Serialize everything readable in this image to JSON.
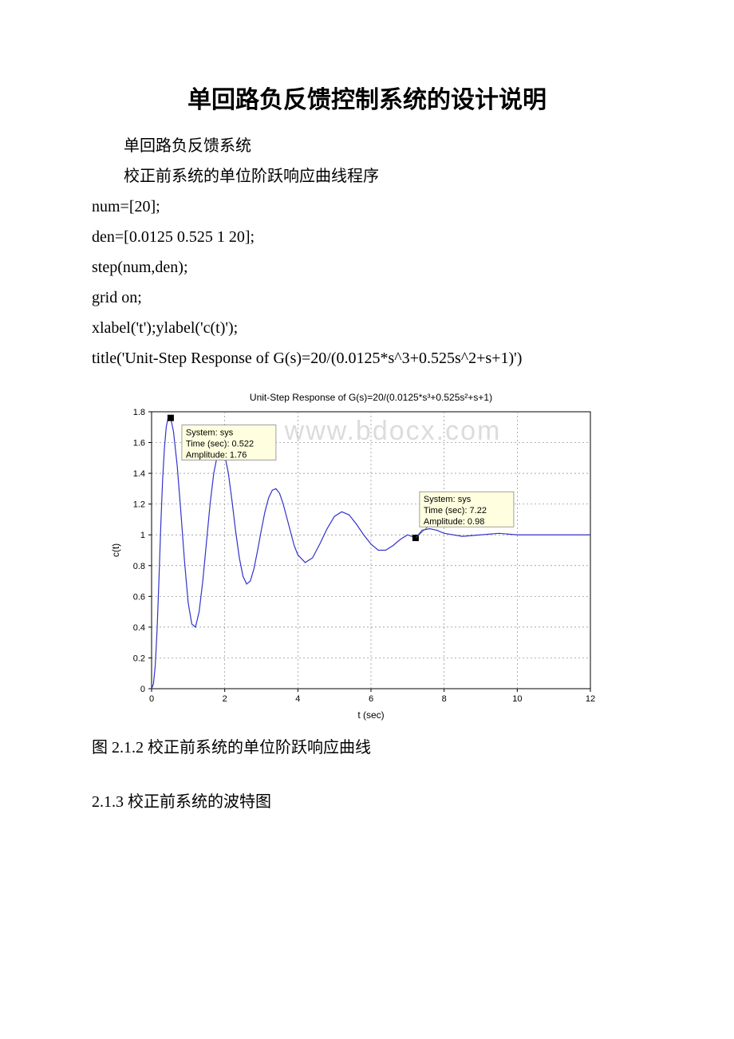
{
  "title": "单回路负反馈控制系统的设计说明",
  "lines": {
    "l1": "单回路负反馈系统",
    "l2": "校正前系统的单位阶跃响应曲线程序",
    "c1": "num=[20];",
    "c2": "den=[0.0125 0.525 1 20];",
    "c3": "step(num,den);",
    "c4": "grid on;",
    "c5": "xlabel('t');ylabel('c(t)');",
    "c6": "title('Unit-Step Response of G(s)=20/(0.0125*s^3+0.525s^2+s+1)')"
  },
  "caption": "图 2.1.2 校正前系统的单位阶跃响应曲线",
  "section": "2.1.3 校正前系统的波特图",
  "watermark": "www.bdocx.com",
  "chart_data": {
    "type": "line",
    "title": "Unit-Step Response of G(s)=20/(0.0125*s³+0.525s²+s+1)",
    "xlabel": "t (sec)",
    "ylabel": "c(t)",
    "xlim": [
      0,
      12
    ],
    "ylim": [
      0,
      1.8
    ],
    "xticks": [
      0,
      2,
      4,
      6,
      8,
      10,
      12
    ],
    "yticks": [
      0,
      0.2,
      0.4,
      0.6,
      0.8,
      1,
      1.2,
      1.4,
      1.6,
      1.8
    ],
    "grid": true,
    "series": [
      {
        "name": "sys",
        "color": "#3333cc",
        "x": [
          0,
          0.05,
          0.1,
          0.15,
          0.2,
          0.25,
          0.3,
          0.35,
          0.4,
          0.45,
          0.522,
          0.6,
          0.7,
          0.8,
          0.9,
          1.0,
          1.1,
          1.2,
          1.3,
          1.4,
          1.5,
          1.6,
          1.7,
          1.8,
          1.9,
          2.0,
          2.1,
          2.2,
          2.3,
          2.4,
          2.5,
          2.6,
          2.7,
          2.8,
          2.9,
          3.0,
          3.1,
          3.2,
          3.3,
          3.4,
          3.5,
          3.6,
          3.7,
          3.8,
          3.9,
          4.0,
          4.2,
          4.4,
          4.6,
          4.8,
          5.0,
          5.2,
          5.4,
          5.6,
          5.8,
          6.0,
          6.2,
          6.4,
          6.6,
          6.8,
          7.0,
          7.22,
          7.4,
          7.6,
          7.8,
          8.0,
          8.5,
          9.0,
          9.5,
          10.0,
          10.5,
          11.0,
          11.5,
          12.0
        ],
        "y": [
          0,
          0.03,
          0.15,
          0.38,
          0.7,
          1.05,
          1.35,
          1.56,
          1.7,
          1.76,
          1.76,
          1.67,
          1.45,
          1.15,
          0.83,
          0.56,
          0.42,
          0.4,
          0.5,
          0.7,
          0.95,
          1.2,
          1.4,
          1.52,
          1.56,
          1.52,
          1.4,
          1.22,
          1.02,
          0.85,
          0.73,
          0.68,
          0.7,
          0.78,
          0.9,
          1.03,
          1.15,
          1.24,
          1.29,
          1.3,
          1.27,
          1.2,
          1.11,
          1.02,
          0.93,
          0.87,
          0.82,
          0.85,
          0.94,
          1.04,
          1.12,
          1.15,
          1.13,
          1.07,
          1.0,
          0.94,
          0.9,
          0.9,
          0.93,
          0.97,
          1.0,
          0.98,
          1.03,
          1.04,
          1.03,
          1.01,
          0.99,
          1.0,
          1.01,
          1.0,
          1.0,
          1.0,
          1.0,
          1.0
        ]
      }
    ],
    "annotations": [
      {
        "label": "System: sys",
        "sub1": "Time (sec): 0.522",
        "sub2": "Amplitude: 1.76",
        "x": 0.522,
        "y": 1.76
      },
      {
        "label": "System: sys",
        "sub1": "Time (sec): 7.22",
        "sub2": "Amplitude: 0.98",
        "x": 7.22,
        "y": 0.98
      }
    ]
  }
}
